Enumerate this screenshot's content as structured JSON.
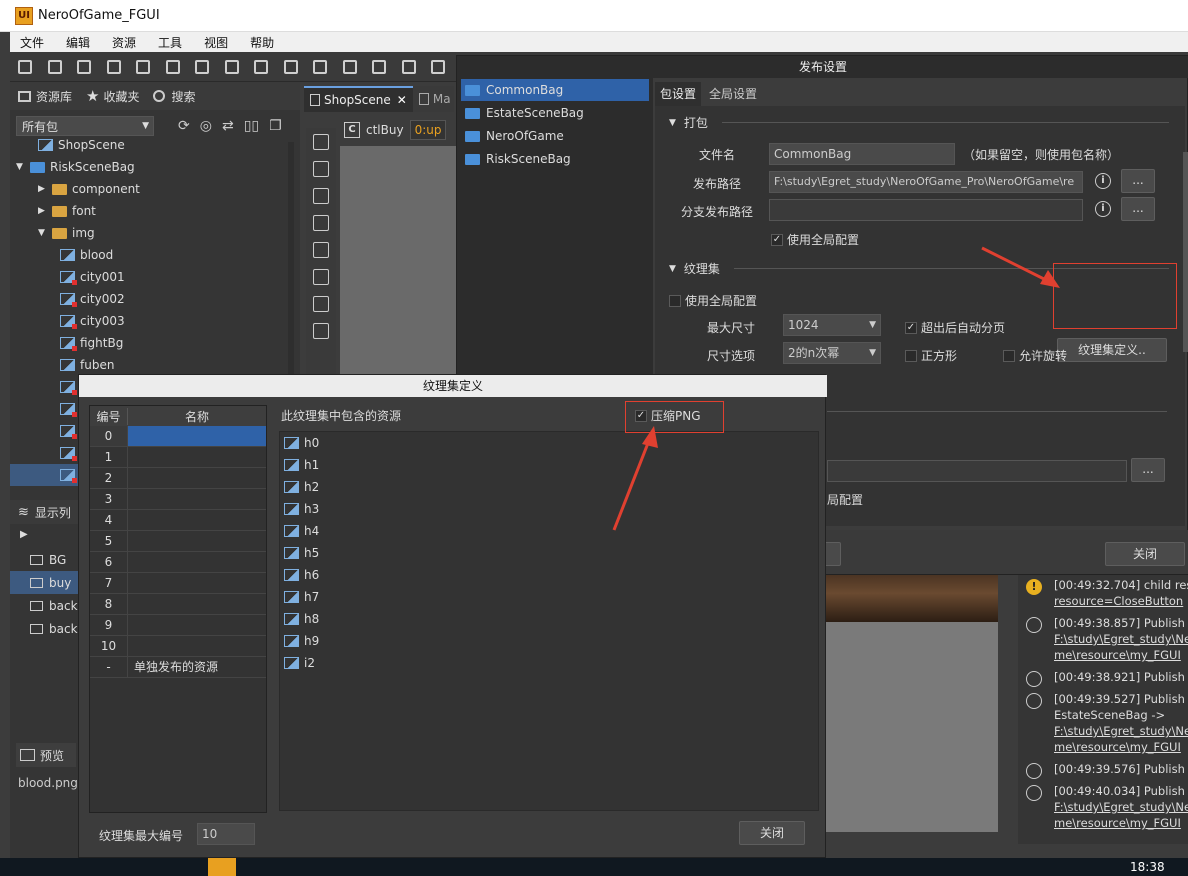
{
  "app": {
    "title": "NeroOfGame_FGUI",
    "logo": "UI"
  },
  "menu": [
    "文件",
    "编辑",
    "资源",
    "工具",
    "视图",
    "帮助"
  ],
  "left_panel": {
    "tabs": [
      "资源库",
      "收藏夹",
      "搜索"
    ],
    "filter": "所有包",
    "tree": [
      {
        "label": "ShopScene",
        "type": "img",
        "indent": 1
      },
      {
        "label": "RiskSceneBag",
        "type": "pkg",
        "indent": 0
      },
      {
        "label": "component",
        "type": "folder",
        "indent": 1
      },
      {
        "label": "font",
        "type": "folder",
        "indent": 1
      },
      {
        "label": "img",
        "type": "folder-open",
        "indent": 1
      },
      {
        "label": "blood",
        "type": "img",
        "indent": 2
      },
      {
        "label": "city001",
        "type": "img-red",
        "indent": 2
      },
      {
        "label": "city002",
        "type": "img-red",
        "indent": 2
      },
      {
        "label": "city003",
        "type": "img-red",
        "indent": 2
      },
      {
        "label": "fightBg",
        "type": "img-red",
        "indent": 2
      },
      {
        "label": "fuben",
        "type": "img",
        "indent": 2
      }
    ],
    "display_list_title": "显示列",
    "display_items": [
      "BG",
      "buy",
      "back",
      "back"
    ],
    "preview_title": "预览",
    "preview_file": "blood.png"
  },
  "scene_tabs": {
    "active": "ShopScene",
    "next": "Ma"
  },
  "ctl": {
    "label": "ctlBuy",
    "value": "0:up"
  },
  "publish": {
    "title": "发布设置",
    "packages": [
      "CommonBag",
      "EstateSceneBag",
      "NeroOfGame",
      "RiskSceneBag"
    ],
    "tabs": [
      "包设置",
      "全局设置"
    ],
    "pack_section": "打包",
    "file_name_label": "文件名",
    "file_name": "CommonBag",
    "file_name_hint": "（如果留空，则使用包名称）",
    "path_label": "发布路径",
    "path": "F:\\study\\Egret_study\\NeroOfGame_Pro\\NeroOfGame\\re",
    "branch_label": "分支发布路径",
    "branch": "",
    "use_global": "使用全局配置",
    "atlas_section": "纹理集",
    "atlas_use_global": "使用全局配置",
    "atlas_define_btn": "纹理集定义..",
    "max_size_label": "最大尺寸",
    "max_size": "1024",
    "auto_split": "超出后自动分页",
    "size_opt_label": "尺寸选项",
    "size_opt": "2的n次幂",
    "square": "正方形",
    "rotate": "允许旋转",
    "partial_global": "局配置",
    "close": "关闭",
    "dots": "..."
  },
  "atlas_dialog": {
    "title": "纹理集定义",
    "col_num": "编号",
    "col_name": "名称",
    "rows": [
      "0",
      "1",
      "2",
      "3",
      "4",
      "5",
      "6",
      "7",
      "8",
      "9",
      "10"
    ],
    "last_row": {
      "num": "-",
      "name": "单独发布的资源"
    },
    "contains_label": "此纹理集中包含的资源",
    "compress": "压缩PNG",
    "assets": [
      "h0",
      "h1",
      "h2",
      "h3",
      "h4",
      "h5",
      "h6",
      "h7",
      "h8",
      "h9",
      "i2"
    ],
    "max_label": "纹理集最大编号",
    "max_value": "10",
    "close": "关闭"
  },
  "log": [
    {
      "type": "warn",
      "lines": [
        "[00:49:32.704] child res",
        "resource=CloseButton"
      ]
    },
    {
      "type": "msg",
      "lines": [
        "[00:49:38.857] Publish c",
        "F:\\study\\Egret_study\\Ne",
        "me\\resource\\my_FGUI"
      ]
    },
    {
      "type": "msg",
      "lines": [
        "[00:49:38.921] Publish s"
      ]
    },
    {
      "type": "msg",
      "lines": [
        "[00:49:39.527] Publish c",
        "EstateSceneBag ->",
        "F:\\study\\Egret_study\\Ne",
        "me\\resource\\my_FGUI"
      ]
    },
    {
      "type": "msg",
      "lines": [
        "[00:49:39.576] Publish s"
      ]
    },
    {
      "type": "msg",
      "lines": [
        "[00:49:40.034] Publish c",
        "F:\\study\\Egret_study\\Ne",
        "me\\resource\\my_FGUI"
      ]
    }
  ],
  "taskbar": {
    "time": "18:38"
  },
  "colors": {
    "accent": "#2f62a8",
    "highlight_red": "#e04030"
  }
}
